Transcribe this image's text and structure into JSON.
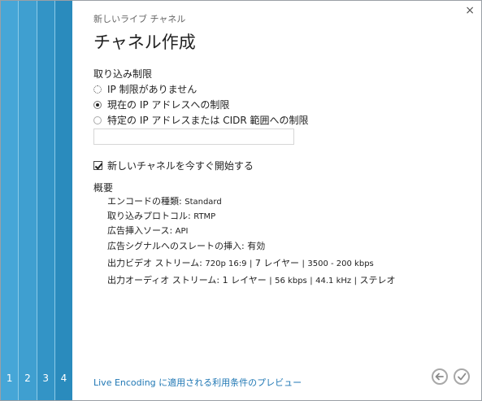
{
  "header": {
    "subtitle": "新しいライブ チャネル",
    "title": "チャネル作成",
    "close_glyph": "×"
  },
  "steps": [
    "1",
    "2",
    "3",
    "4"
  ],
  "ingest": {
    "label": "取り込み制限",
    "options": [
      {
        "label": "IP 制限がありません",
        "selected": false
      },
      {
        "label": "現在の IP アドレスへの制限",
        "selected": true
      },
      {
        "label": "特定の IP アドレスまたは CIDR 範囲への制限",
        "selected": false
      }
    ],
    "cidr_value": ""
  },
  "start_now": {
    "label": "新しいチャネルを今すぐ開始する",
    "checked": true
  },
  "summary": {
    "label": "概要",
    "encoding_type_label": "エンコードの種類:",
    "encoding_type_value": "Standard",
    "protocol_label": "取り込みプロトコル:",
    "protocol_value": "RTMP",
    "ad_source_label": "広告挿入ソース:",
    "ad_source_value": "API",
    "slate_label": "広告シグナルへのスレートの挿入:",
    "slate_value": "有効",
    "video_label": "出力ビデオ ストリーム:",
    "video_value_a": "720p 16:9",
    "video_value_b": "7 レイヤー",
    "video_value_c": "3500 - 200 kbps",
    "audio_label": "出力オーディオ ストリーム:",
    "audio_value_a": "1 レイヤー",
    "audio_value_b": "56 kbps",
    "audio_value_c": "44.1 kHz",
    "audio_value_d": "ステレオ",
    "separator": "|"
  },
  "footer": {
    "preview_link": "Live Encoding に適用される利用条件のプレビュー"
  },
  "icons": {
    "back": "back-arrow-icon",
    "confirm": "checkmark-icon"
  }
}
